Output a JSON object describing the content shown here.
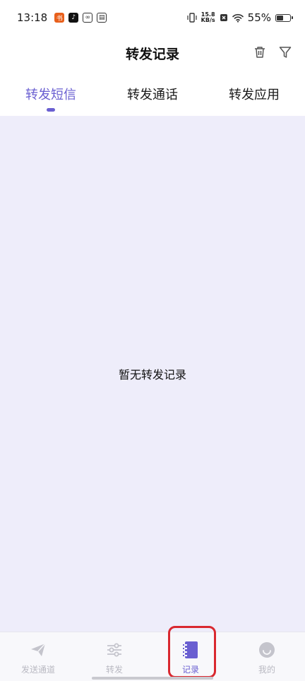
{
  "status_bar": {
    "time": "13:18",
    "net_speed_value": "15.8",
    "net_speed_unit": "KB/s",
    "battery_percent_label": "55%",
    "battery_level": 0.55
  },
  "header": {
    "title": "转发记录",
    "actions": [
      "trash-icon",
      "filter-icon"
    ]
  },
  "tabs": [
    {
      "label": "转发短信",
      "active": true
    },
    {
      "label": "转发通话",
      "active": false
    },
    {
      "label": "转发应用",
      "active": false
    }
  ],
  "content": {
    "empty_message": "暂无转发记录"
  },
  "bottom_nav": [
    {
      "label": "发送通道",
      "icon": "send-icon",
      "active": false
    },
    {
      "label": "转发",
      "icon": "sliders-icon",
      "active": false
    },
    {
      "label": "记录",
      "icon": "notebook-icon",
      "active": true
    },
    {
      "label": "我的",
      "icon": "smile-icon",
      "active": false
    }
  ],
  "colors": {
    "accent": "#6a5fd1",
    "content_bg": "#eeedfa",
    "highlight": "#d9282f"
  }
}
